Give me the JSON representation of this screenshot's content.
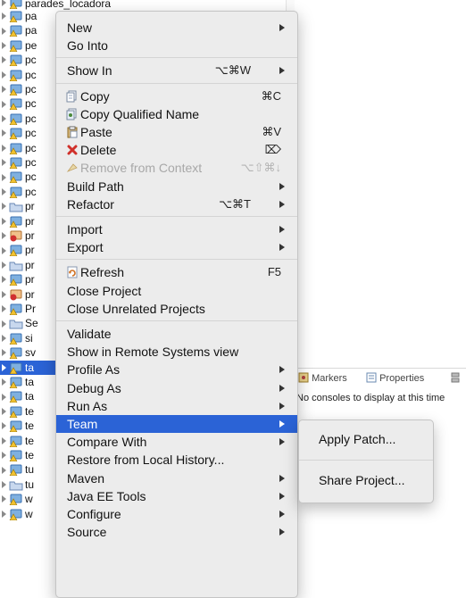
{
  "explorer": {
    "top_item": "parades_locadora",
    "rows": [
      {
        "name": "pa",
        "icon": "project-warning"
      },
      {
        "name": "pa",
        "icon": "project-warning"
      },
      {
        "name": "pe",
        "icon": "project-warning"
      },
      {
        "name": "pc",
        "icon": "project-warning"
      },
      {
        "name": "pc",
        "icon": "project-warning"
      },
      {
        "name": "pc",
        "icon": "project-warning"
      },
      {
        "name": "pc",
        "icon": "project-warning"
      },
      {
        "name": "pc",
        "icon": "project-warning"
      },
      {
        "name": "pc",
        "icon": "project-warning"
      },
      {
        "name": "pc",
        "icon": "project-warning"
      },
      {
        "name": "pc",
        "icon": "project-warning"
      },
      {
        "name": "pc",
        "icon": "project-warning"
      },
      {
        "name": "pc",
        "icon": "project-warning"
      },
      {
        "name": "pr",
        "icon": "folder"
      },
      {
        "name": "pr",
        "icon": "project-warning"
      },
      {
        "name": "pr",
        "icon": "project-error"
      },
      {
        "name": "pr",
        "icon": "project-warning"
      },
      {
        "name": "pr",
        "icon": "folder"
      },
      {
        "name": "pr",
        "icon": "project-warning"
      },
      {
        "name": "pr",
        "icon": "project-error"
      },
      {
        "name": "Pr",
        "icon": "project-warning"
      },
      {
        "name": "Se",
        "icon": "folder"
      },
      {
        "name": "si",
        "icon": "project-warning"
      },
      {
        "name": "sv",
        "icon": "project-warning"
      },
      {
        "name": "ta",
        "icon": "project-warning",
        "selected": true
      },
      {
        "name": "ta",
        "icon": "project-warning"
      },
      {
        "name": "ta",
        "icon": "project-warning"
      },
      {
        "name": "te",
        "icon": "project-warning"
      },
      {
        "name": "te",
        "icon": "project-warning"
      },
      {
        "name": "te",
        "icon": "project-warning"
      },
      {
        "name": "te",
        "icon": "project-warning"
      },
      {
        "name": "tu",
        "icon": "project-warning"
      },
      {
        "name": "tu",
        "icon": "folder"
      },
      {
        "name": "w",
        "icon": "project-warning"
      },
      {
        "name": "w",
        "icon": "project-warning"
      }
    ]
  },
  "console": {
    "tabs": [
      {
        "label": "Markers",
        "icon": "markers-icon"
      },
      {
        "label": "Properties",
        "icon": "properties-icon"
      },
      {
        "label": "",
        "icon": "servers-icon"
      }
    ],
    "message": "No consoles to display at this time"
  },
  "context_menu": {
    "items": [
      {
        "label": "New",
        "submenu": true
      },
      {
        "label": "Go Into"
      },
      {
        "separator": true
      },
      {
        "label": "Show In",
        "shortcut": "⌥⌘W",
        "submenu": true
      },
      {
        "separator": true
      },
      {
        "label": "Copy",
        "shortcut": "⌘C",
        "icon": "copy-icon"
      },
      {
        "label": "Copy Qualified Name",
        "icon": "copy-qualified-name-icon"
      },
      {
        "label": "Paste",
        "shortcut": "⌘V",
        "icon": "paste-icon"
      },
      {
        "label": "Delete",
        "shortcut": "⌦",
        "icon": "delete-icon"
      },
      {
        "label": "Remove from Context",
        "shortcut": "⌥⇧⌘↓",
        "icon": "remove-from-context-icon",
        "disabled": true
      },
      {
        "label": "Build Path",
        "submenu": true
      },
      {
        "label": "Refactor",
        "shortcut": "⌥⌘T",
        "submenu": true
      },
      {
        "separator": true
      },
      {
        "label": "Import",
        "submenu": true
      },
      {
        "label": "Export",
        "submenu": true
      },
      {
        "separator": true
      },
      {
        "label": "Refresh",
        "shortcut": "F5",
        "icon": "refresh-icon"
      },
      {
        "label": "Close Project"
      },
      {
        "label": "Close Unrelated Projects"
      },
      {
        "separator": true
      },
      {
        "label": "Validate"
      },
      {
        "label": "Show in Remote Systems view"
      },
      {
        "label": "Profile As",
        "submenu": true
      },
      {
        "label": "Debug As",
        "submenu": true
      },
      {
        "label": "Run As",
        "submenu": true
      },
      {
        "label": "Team",
        "submenu": true,
        "highlighted": true
      },
      {
        "label": "Compare With",
        "submenu": true
      },
      {
        "label": "Restore from Local History..."
      },
      {
        "label": "Maven",
        "submenu": true
      },
      {
        "label": "Java EE Tools",
        "submenu": true
      },
      {
        "label": "Configure",
        "submenu": true
      },
      {
        "label": "Source",
        "submenu": true
      }
    ]
  },
  "team_submenu": {
    "items": [
      {
        "label": "Apply Patch..."
      },
      {
        "separator": true
      },
      {
        "label": "Share Project..."
      }
    ]
  },
  "colors": {
    "selection": "#2b63d6",
    "menu_bg": "#ececec",
    "disabled_text": "#a8a8a8"
  }
}
